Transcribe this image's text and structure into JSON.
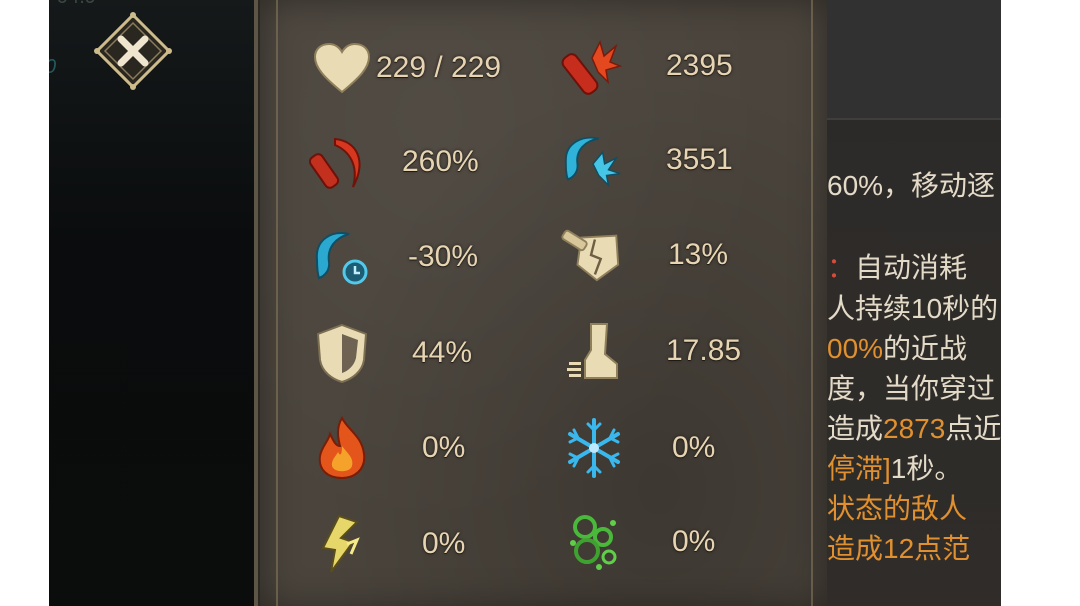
{
  "left": {
    "frag_top": "94.9",
    "frag_mid": "0"
  },
  "close_button": {
    "icon": "close-icon"
  },
  "stats": [
    {
      "name": "health",
      "icon": "heart-icon",
      "value": "229 / 229"
    },
    {
      "name": "attack",
      "icon": "dynamite-attack-icon",
      "value": "2395"
    },
    {
      "name": "crit-damage",
      "icon": "red-slash-icon",
      "value": "260%"
    },
    {
      "name": "cold-attack",
      "icon": "blue-slash-icon",
      "value": "3551"
    },
    {
      "name": "cooldown",
      "icon": "blue-slash-clock-icon",
      "value": "-30%"
    },
    {
      "name": "armor-break",
      "icon": "broken-shield-icon",
      "value": "13%"
    },
    {
      "name": "defense",
      "icon": "shield-icon",
      "value": "44%"
    },
    {
      "name": "move-speed",
      "icon": "boot-icon",
      "value": "17.85"
    },
    {
      "name": "fire-resist",
      "icon": "fire-icon",
      "value": "0%"
    },
    {
      "name": "cold-resist",
      "icon": "snowflake-icon",
      "value": "0%"
    },
    {
      "name": "lightning-resist",
      "icon": "lightning-icon",
      "value": "0%"
    },
    {
      "name": "poison-resist",
      "icon": "poison-bubbles-icon",
      "value": "0%"
    }
  ],
  "description": {
    "line1": "60%，移动逐",
    "line2_label": "：",
    "line2_text": "自动消耗",
    "line3": "人持续10秒的",
    "line4_highlight": "00%",
    "line4_text": "的近战",
    "line5": "度，当你穿过",
    "line6_prefix": "造成",
    "line6_highlight": "2873",
    "line6_suffix": "点近",
    "line7_highlight": "停滞]",
    "line7_text": "1秒。",
    "line8": "状态的敌人",
    "line9": "造成12点范"
  },
  "colors": {
    "panel": "#4a443c",
    "value_text": "#e6d4b3",
    "desc_text": "#e4dac8",
    "highlight_orange": "#e0902f",
    "highlight_red": "#d64b3a"
  }
}
